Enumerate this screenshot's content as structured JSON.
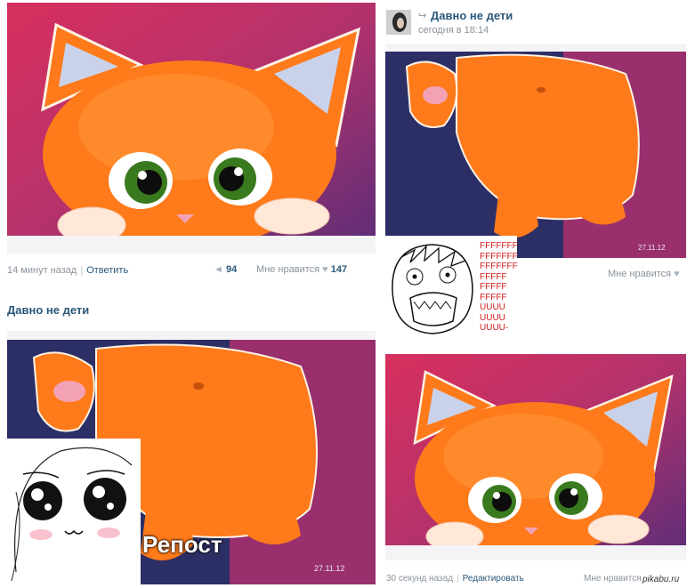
{
  "post_left_top": {
    "meta_time": "14 минут назад",
    "reply": "Ответить",
    "reposts_count": "94",
    "like_label": "Мне нравится",
    "likes_count": "147"
  },
  "post_left_bottom": {
    "title": "Давно не дети"
  },
  "post_right_top": {
    "title": "Давно не дети",
    "time": "сегодня в 18:14",
    "like_label": "Мне нравится"
  },
  "post_right_bottom": {
    "meta_time": "30 секунд назад",
    "edit": "Редактировать",
    "like_label": "Мне нравится"
  },
  "rage_text": [
    "FFFFFFF",
    "FFFFFFF",
    "FFFFFFF",
    "FFFFF",
    "FFFFF",
    "FFFFF",
    "UUUU",
    "UUUU",
    "UUUU-"
  ],
  "repost_label": "Репост",
  "watermark": "pikabu.ru",
  "painting_signature": "27.11.12",
  "colors": {
    "link": "#2b587a",
    "meta": "#8a939c",
    "rage_red": "#d41b1b",
    "cat_orange": "#ff7a1a"
  }
}
